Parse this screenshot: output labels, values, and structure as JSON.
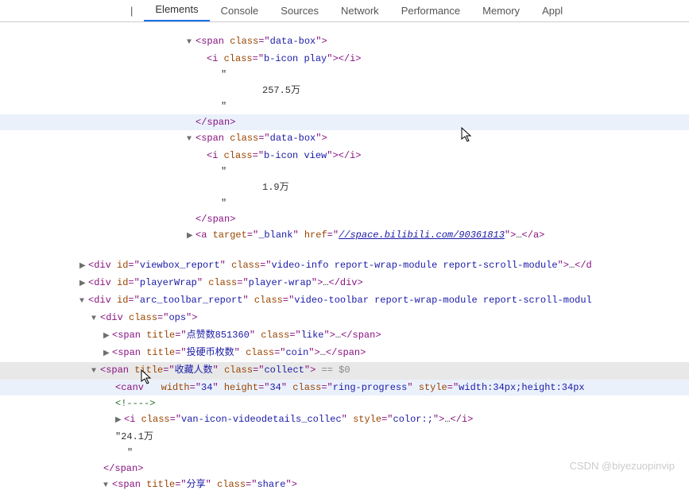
{
  "tabs": {
    "first": " |",
    "elements": "Elements",
    "console": "Console",
    "sources": "Sources",
    "network": "Network",
    "performance": "Performance",
    "memory": "Memory",
    "application": "Appl"
  },
  "dom": {
    "span1_open": "span",
    "class_attr": "class",
    "databox": "data-box",
    "i_tag": "i",
    "bicon_play": "b-icon play",
    "quote": "\"",
    "play_count": "257.5万",
    "span_close": "span",
    "bicon_view": "b-icon view",
    "view_count": "1.9万",
    "a_tag": "a",
    "target_attr": "target",
    "blank": "_blank",
    "href_attr": "href",
    "href_val": "//space.bilibili.com/90361813",
    "div_tag": "div",
    "id_attr": "id",
    "viewbox_id": "viewbox_report",
    "viewbox_class": "video-info report-wrap-module report-scroll-module",
    "playerwrap_id": "playerWrap",
    "playerwrap_class": "player-wrap",
    "toolbar_id": "arc_toolbar_report",
    "toolbar_class": "video-toolbar report-wrap-module report-scroll-modul",
    "ops_class": "ops",
    "like_title": "点赞数851360",
    "like_class": "like",
    "title_attr": "title",
    "coin_title": "投硬币枚数",
    "coin_class": "coin",
    "collect_title": "收藏人数",
    "collect_class": "collect",
    "eq_zero": " == $0",
    "canvas_tag": "canv",
    "width_attr": "width",
    "w34": "34",
    "height_attr": "height",
    "h34": "34",
    "ring_class": "ring-progress",
    "style_attr": "style",
    "style_val": "width:34px;height:34px",
    "comment_open": "<!---->",
    "van_icon_class": "van-icon-videodetails_collec",
    "color_style": "color:;",
    "collect_count": "24.1万",
    "share_title": "分享",
    "share_class": "share",
    "ellips": "…"
  },
  "watermark": "CSDN @biyezuopinvip"
}
